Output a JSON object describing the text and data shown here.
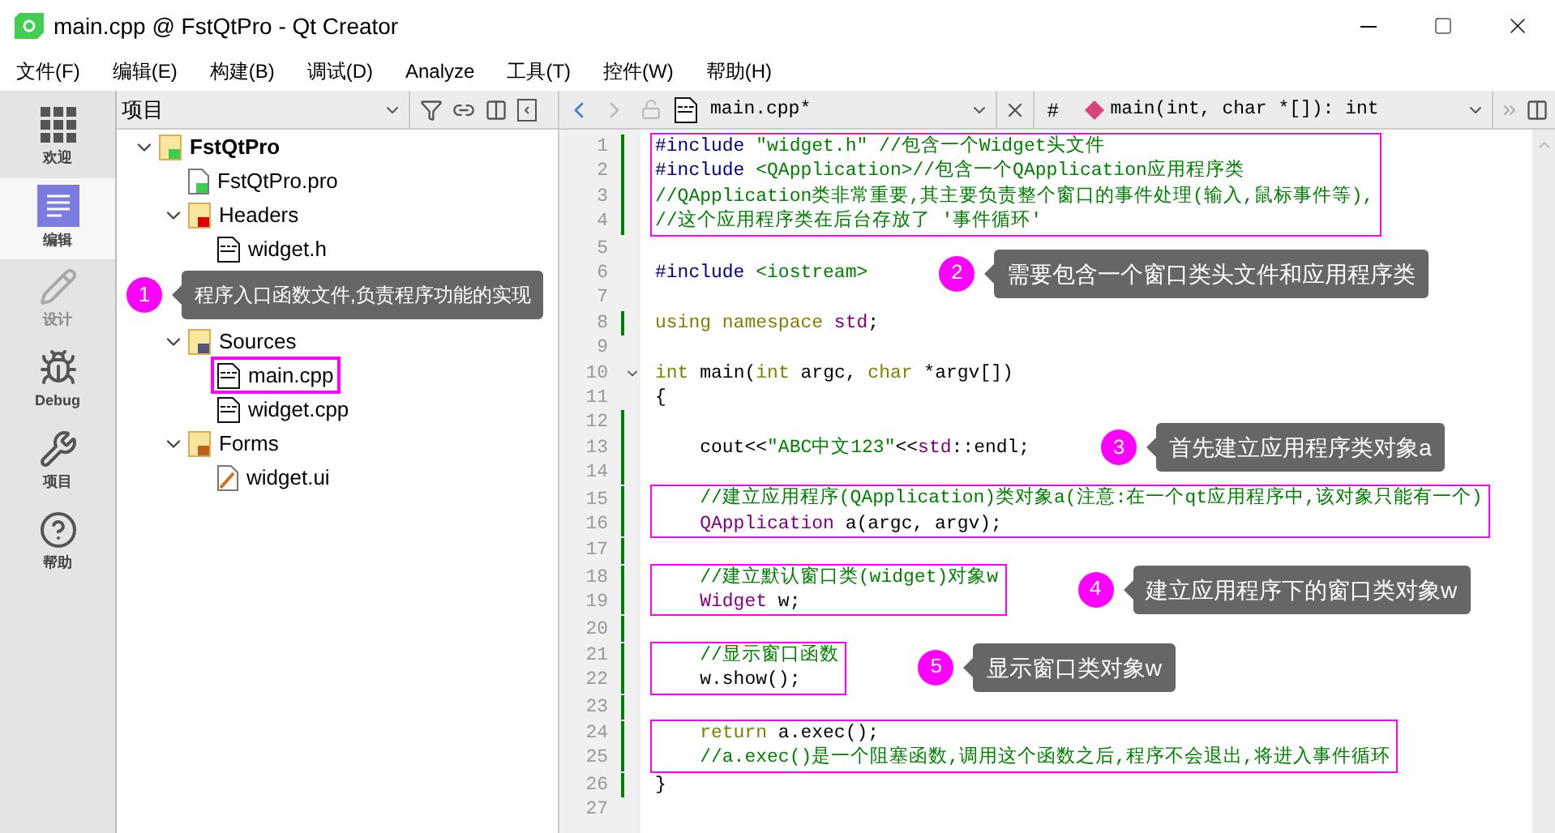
{
  "window": {
    "title": "main.cpp @ FstQtPro - Qt Creator"
  },
  "menu": [
    "文件(F)",
    "编辑(E)",
    "构建(B)",
    "调试(D)",
    "Analyze",
    "工具(T)",
    "控件(W)",
    "帮助(H)"
  ],
  "modes": [
    {
      "kind": "welcome",
      "label": "欢迎",
      "selected": false,
      "disabled": false
    },
    {
      "kind": "edit",
      "label": "编辑",
      "selected": true,
      "disabled": false
    },
    {
      "kind": "design",
      "label": "设计",
      "selected": false,
      "disabled": true
    },
    {
      "kind": "debug",
      "label": "Debug",
      "selected": false,
      "disabled": false
    },
    {
      "kind": "projects",
      "label": "项目",
      "selected": false,
      "disabled": false
    },
    {
      "kind": "help",
      "label": "帮助",
      "selected": false,
      "disabled": false
    }
  ],
  "project_panel": {
    "view": "项目",
    "tree": [
      {
        "kind": "project",
        "label": "FstQtPro",
        "expanded": true,
        "marked": false,
        "children": [
          {
            "kind": "pro",
            "label": "FstQtPro.pro",
            "marked": false
          },
          {
            "kind": "headers",
            "label": "Headers",
            "expanded": true,
            "marked": false,
            "children": [
              {
                "kind": "header",
                "label": "widget.h",
                "marked": false,
                "callout": {
                  "badge": "1",
                  "text": "程序入口函数文件,负责程序功能的实现"
                }
              }
            ]
          },
          {
            "kind": "sources",
            "label": "Sources",
            "expanded": true,
            "marked": false,
            "children": [
              {
                "kind": "source",
                "label": "main.cpp",
                "marked": true
              },
              {
                "kind": "source",
                "label": "widget.cpp",
                "marked": false
              }
            ]
          },
          {
            "kind": "forms",
            "label": "Forms",
            "expanded": true,
            "marked": false,
            "children": [
              {
                "kind": "form",
                "label": "widget.ui",
                "marked": false
              }
            ]
          }
        ]
      }
    ]
  },
  "editor": {
    "file": "main.cpp*",
    "hash": "#",
    "symbol": "main(int, char *[]): int",
    "blocks": [
      {
        "boxed": true,
        "lines": [
          {
            "number": "1",
            "modified": true,
            "segments": [
              {
                "text": "#include ",
                "kind": "preproc"
              },
              {
                "text": "\"widget.h\"",
                "kind": "string"
              },
              {
                "text": " //包含一个Widget头文件",
                "kind": "comment"
              }
            ]
          },
          {
            "number": "2",
            "modified": true,
            "segments": [
              {
                "text": "#include ",
                "kind": "preproc"
              },
              {
                "text": "<QApplication>",
                "kind": "string"
              },
              {
                "text": "//包含一个QApplication应用程序类",
                "kind": "comment"
              }
            ]
          },
          {
            "number": "3",
            "modified": true,
            "segments": [
              {
                "text": "//QApplication类非常重要,其主要负责整个窗口的事件处理(输入,鼠标事件等),",
                "kind": "comment"
              }
            ]
          },
          {
            "number": "4",
            "modified": true,
            "segments": [
              {
                "text": "//这个应用程序类在后台存放了 '事件循环'",
                "kind": "comment"
              }
            ]
          }
        ]
      },
      {
        "boxed": false,
        "lines": [
          {
            "number": "5",
            "modified": false
          }
        ]
      },
      {
        "boxed": false,
        "callout": {
          "badge": "2",
          "text": "需要包含一个窗口类头文件和应用程序类"
        },
        "lines": [
          {
            "number": "6",
            "modified": false,
            "segments": [
              {
                "text": "#include ",
                "kind": "preproc"
              },
              {
                "text": "<iostream>",
                "kind": "string"
              }
            ]
          }
        ]
      },
      {
        "boxed": false,
        "lines": [
          {
            "number": "7",
            "modified": false
          },
          {
            "number": "8",
            "modified": true,
            "segments": [
              {
                "text": "using namespace ",
                "kind": "keyword"
              },
              {
                "text": "std",
                "kind": "type"
              },
              {
                "text": ";",
                "kind": "plain"
              }
            ]
          },
          {
            "number": "9",
            "modified": false
          },
          {
            "number": "10",
            "modified": false,
            "foldable": true,
            "segments": [
              {
                "text": "int",
                "kind": "keyword"
              },
              {
                "text": " main(",
                "kind": "plain"
              },
              {
                "text": "int",
                "kind": "keyword"
              },
              {
                "text": " argc, ",
                "kind": "plain"
              },
              {
                "text": "char",
                "kind": "keyword"
              },
              {
                "text": " *argv[])",
                "kind": "plain"
              }
            ]
          },
          {
            "number": "11",
            "modified": false,
            "segments": [
              {
                "text": "{",
                "kind": "plain"
              }
            ]
          },
          {
            "number": "12",
            "modified": true
          }
        ]
      },
      {
        "boxed": false,
        "callout": {
          "badge": "3",
          "text": "首先建立应用程序类对象a"
        },
        "lines": [
          {
            "number": "13",
            "modified": true,
            "segments": [
              {
                "text": "    cout<<",
                "kind": "plain"
              },
              {
                "text": "\"ABC中文123\"",
                "kind": "string"
              },
              {
                "text": "<<",
                "kind": "plain"
              },
              {
                "text": "std",
                "kind": "type"
              },
              {
                "text": "::endl;",
                "kind": "plain"
              }
            ]
          }
        ]
      },
      {
        "boxed": false,
        "lines": [
          {
            "number": "14",
            "modified": true
          }
        ]
      },
      {
        "boxed": true,
        "lines": [
          {
            "number": "15",
            "modified": true,
            "segments": [
              {
                "text": "    //建立应用程序(QApplication)类对象a(注意:在一个qt应用程序中,该对象只能有一个)",
                "kind": "comment"
              }
            ]
          },
          {
            "number": "16",
            "modified": true,
            "segments": [
              {
                "text": "    QApplication",
                "kind": "type"
              },
              {
                "text": " a(argc, argv);",
                "kind": "plain"
              }
            ]
          }
        ]
      },
      {
        "boxed": false,
        "lines": [
          {
            "number": "17",
            "modified": true
          }
        ]
      },
      {
        "boxed": true,
        "callout": {
          "badge": "4",
          "text": "建立应用程序下的窗口类对象w"
        },
        "lines": [
          {
            "number": "18",
            "modified": true,
            "segments": [
              {
                "text": "    //建立默认窗口类(widget)对象w",
                "kind": "comment"
              }
            ]
          },
          {
            "number": "19",
            "modified": true,
            "segments": [
              {
                "text": "    Widget",
                "kind": "type"
              },
              {
                "text": " w;",
                "kind": "plain"
              }
            ]
          }
        ]
      },
      {
        "boxed": false,
        "lines": [
          {
            "number": "20",
            "modified": true
          }
        ]
      },
      {
        "boxed": true,
        "callout": {
          "badge": "5",
          "text": "显示窗口类对象w"
        },
        "lines": [
          {
            "number": "21",
            "modified": true,
            "segments": [
              {
                "text": "    //显示窗口函数",
                "kind": "comment"
              }
            ]
          },
          {
            "number": "22",
            "modified": true,
            "segments": [
              {
                "text": "    w.show();",
                "kind": "plain"
              }
            ]
          }
        ]
      },
      {
        "boxed": false,
        "lines": [
          {
            "number": "23",
            "modified": true
          }
        ]
      },
      {
        "boxed": true,
        "lines": [
          {
            "number": "24",
            "modified": true,
            "segments": [
              {
                "text": "    return",
                "kind": "keyword"
              },
              {
                "text": " a.exec();",
                "kind": "plain"
              }
            ]
          },
          {
            "number": "25",
            "modified": true,
            "segments": [
              {
                "text": "    //a.exec()是一个阻塞函数,调用这个函数之后,程序不会退出,将进入事件循环",
                "kind": "comment"
              }
            ]
          }
        ]
      },
      {
        "boxed": false,
        "lines": [
          {
            "number": "26",
            "modified": true,
            "segments": [
              {
                "text": "}",
                "kind": "plain"
              }
            ]
          },
          {
            "number": "27",
            "modified": false
          }
        ]
      }
    ]
  }
}
